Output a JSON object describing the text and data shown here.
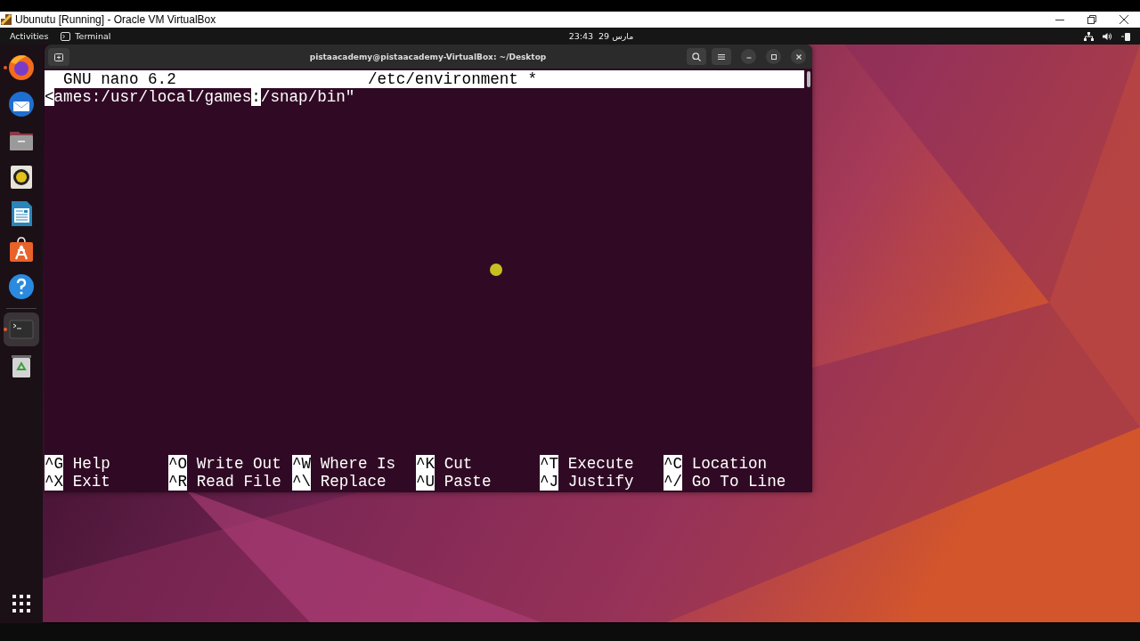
{
  "host_window": {
    "title": "Ubunutu [Running] - Oracle VM VirtualBox"
  },
  "top_bar": {
    "activities": "Activities",
    "app_name": "Terminal",
    "clock": "23:43  مارس 29"
  },
  "dock": {
    "items": [
      {
        "kind": "firefox",
        "running": true,
        "selected": false
      },
      {
        "kind": "thunderbird",
        "running": false,
        "selected": false
      },
      {
        "kind": "files",
        "running": false,
        "selected": false
      },
      {
        "kind": "rhythmbox",
        "running": false,
        "selected": false
      },
      {
        "kind": "writer",
        "running": false,
        "selected": false
      },
      {
        "kind": "software",
        "running": false,
        "selected": false
      },
      {
        "kind": "help",
        "running": false,
        "selected": false
      },
      {
        "kind": "terminal",
        "running": true,
        "selected": true
      },
      {
        "kind": "trash",
        "running": false,
        "selected": false
      }
    ]
  },
  "terminal": {
    "title": "pistaacademy@pistaacademy-VirtualBox: ~/Desktop",
    "nano": {
      "version": "GNU nano 6.2",
      "file": "/etc/environment *",
      "line": [
        {
          "kind": "inverse",
          "text": "<"
        },
        {
          "kind": "plain",
          "text": "ames:/usr/local/games"
        },
        {
          "kind": "cursor",
          "text": ":"
        },
        {
          "kind": "plain",
          "text": "/snap/bin\""
        }
      ],
      "shortcuts": [
        {
          "key": "^G",
          "label": "Help"
        },
        {
          "key": "^O",
          "label": "Write Out"
        },
        {
          "key": "^W",
          "label": "Where Is"
        },
        {
          "key": "^K",
          "label": "Cut"
        },
        {
          "key": "^T",
          "label": "Execute"
        },
        {
          "key": "^C",
          "label": "Location"
        },
        {
          "key": "^X",
          "label": "Exit"
        },
        {
          "key": "^R",
          "label": "Read File"
        },
        {
          "key": "^\\",
          "label": "Replace"
        },
        {
          "key": "^U",
          "label": "Paste"
        },
        {
          "key": "^J",
          "label": "Justify"
        },
        {
          "key": "^/",
          "label": "Go To Line"
        }
      ]
    }
  }
}
